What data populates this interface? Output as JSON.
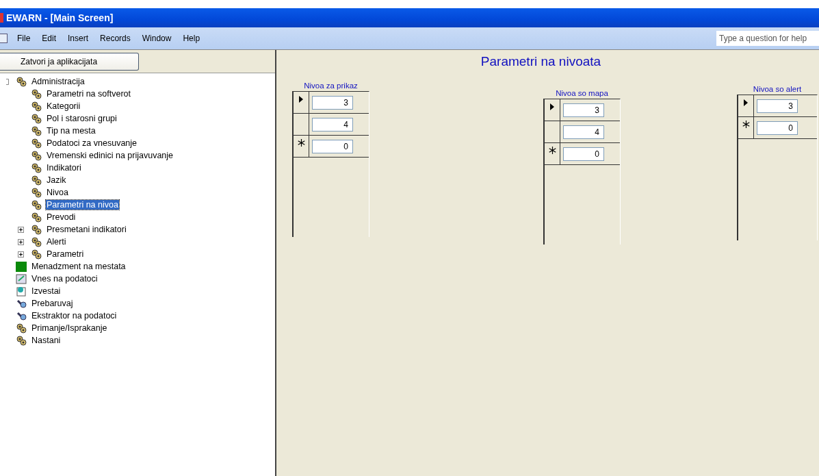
{
  "window": {
    "title": "EWARN - [Main Screen]"
  },
  "menu": [
    "File",
    "Edit",
    "Insert",
    "Records",
    "Window",
    "Help"
  ],
  "help_box": {
    "placeholder": "Type a question for help"
  },
  "close_button": "Zatvori ja aplikacijata",
  "tree": [
    {
      "label": "Administracija",
      "kind": "gears",
      "expanded": true,
      "selected": false,
      "children": [
        {
          "label": "Parametri na softverot",
          "kind": "gears",
          "selected": false
        },
        {
          "label": "Kategorii",
          "kind": "gears",
          "selected": false
        },
        {
          "label": "Pol i starosni grupi",
          "kind": "gears",
          "selected": false
        },
        {
          "label": "Tip na mesta",
          "kind": "gears",
          "selected": false
        },
        {
          "label": "Podatoci za vnesuvanje",
          "kind": "gears",
          "selected": false
        },
        {
          "label": "Vremenski edinici na prijavuvanje",
          "kind": "gears",
          "selected": false
        },
        {
          "label": "Indikatori",
          "kind": "gears",
          "selected": false
        },
        {
          "label": "Jazik",
          "kind": "gears",
          "selected": false
        },
        {
          "label": "Nivoa",
          "kind": "gears",
          "selected": false
        },
        {
          "label": "Parametri na nivoa",
          "kind": "gears",
          "selected": true
        },
        {
          "label": "Prevodi",
          "kind": "gears",
          "selected": false
        },
        {
          "label": "Presmetani indikatori",
          "kind": "gears",
          "selected": false,
          "expanded": false
        },
        {
          "label": "Alerti",
          "kind": "gears",
          "selected": false,
          "expanded": false
        },
        {
          "label": "Parametri",
          "kind": "gears",
          "selected": false,
          "expanded": false
        }
      ]
    },
    {
      "label": "Menadzment na mestata",
      "kind": "folder",
      "selected": false
    },
    {
      "label": "Vnes na podatoci",
      "kind": "form",
      "selected": false
    },
    {
      "label": "Izvestai",
      "kind": "report",
      "selected": false
    },
    {
      "label": "Prebaruvaj",
      "kind": "tool",
      "selected": false
    },
    {
      "label": "Ekstraktor na podatoci",
      "kind": "tool",
      "selected": false
    },
    {
      "label": "Primanje/Isprakanje",
      "kind": "gears",
      "selected": false
    },
    {
      "label": "Nastani",
      "kind": "gears",
      "selected": false
    }
  ],
  "form": {
    "title": "Parametri na nivoata",
    "subforms": [
      {
        "label": "Nivoa za prikaz",
        "rows": [
          {
            "kind": "current",
            "value": "3"
          },
          {
            "kind": "normal",
            "value": "4"
          },
          {
            "kind": "new",
            "value": "0"
          }
        ]
      },
      {
        "label": "Nivoa so mapa",
        "rows": [
          {
            "kind": "current",
            "value": "3"
          },
          {
            "kind": "normal",
            "value": "4"
          },
          {
            "kind": "new",
            "value": "0"
          }
        ]
      },
      {
        "label": "Nivoa so alert",
        "rows": [
          {
            "kind": "current",
            "value": "3"
          },
          {
            "kind": "new",
            "value": "0"
          }
        ]
      }
    ]
  }
}
